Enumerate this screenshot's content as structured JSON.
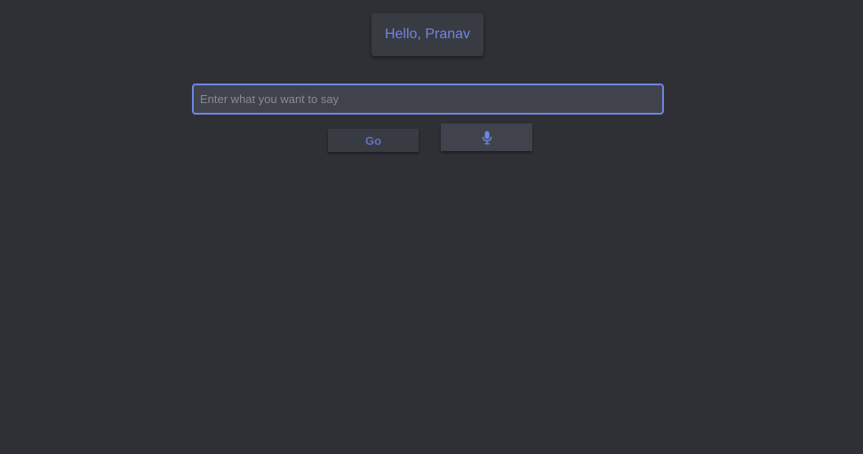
{
  "header": {
    "greeting": "Hello, Pranav"
  },
  "composer": {
    "placeholder": "Enter what you want to say",
    "value": ""
  },
  "actions": {
    "go_label": "Go",
    "mic_icon": "microphone-icon"
  },
  "colors": {
    "background": "#2f3036",
    "accent": "#6f86e3",
    "panel": "#393b43"
  }
}
